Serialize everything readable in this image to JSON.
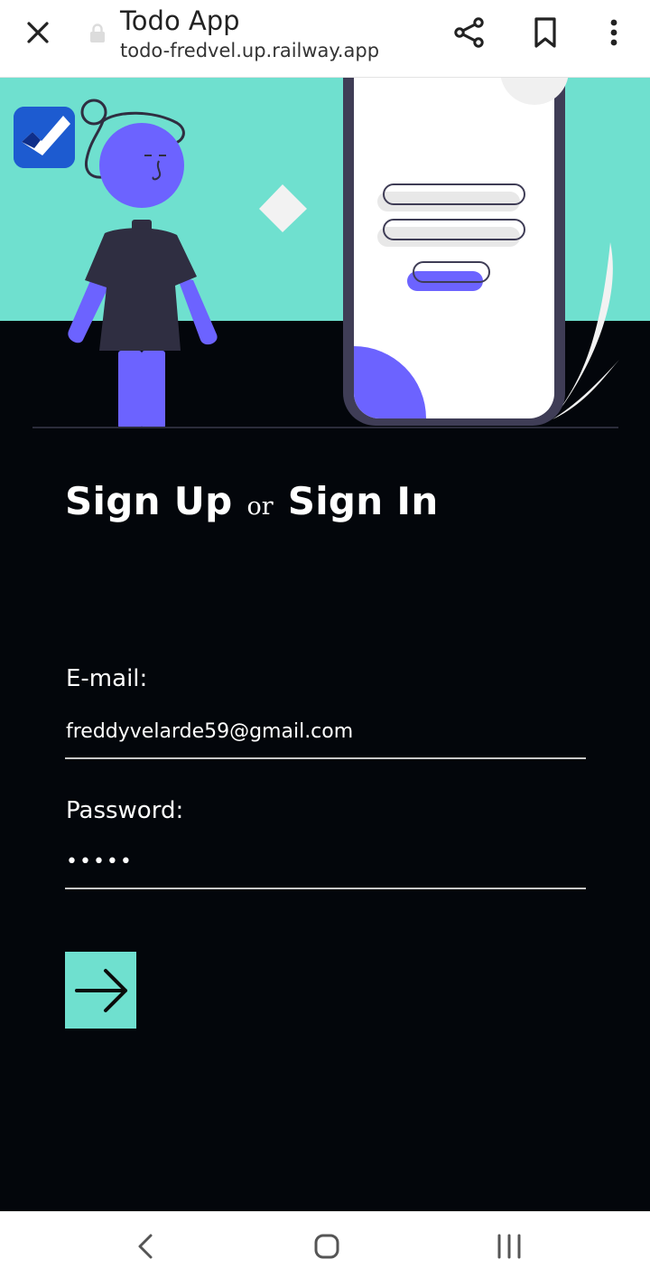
{
  "browser": {
    "title": "Todo App",
    "url": "todo-fredvel.up.railway.app",
    "icons": {
      "close": "close-icon",
      "lock": "lock-icon",
      "share": "share-icon",
      "bookmark": "bookmark-icon",
      "more": "more-vert-icon"
    }
  },
  "heading": {
    "sign_up": "Sign Up",
    "or": "or",
    "sign_in": "Sign In"
  },
  "form": {
    "email_label": "E-mail:",
    "email_value": "freddyvelarde59@gmail.com",
    "password_label": "Password:",
    "password_value": "•••••",
    "submit_icon": "arrow-right-icon"
  },
  "navbar": {
    "icons": [
      "back-icon",
      "home-icon",
      "recents-icon"
    ]
  },
  "colors": {
    "background": "#03060b",
    "accent_teal": "#6fe0cf",
    "illustration_purple": "#6c63ff",
    "illustration_dark": "#3f3d56",
    "text": "#ffffff"
  }
}
